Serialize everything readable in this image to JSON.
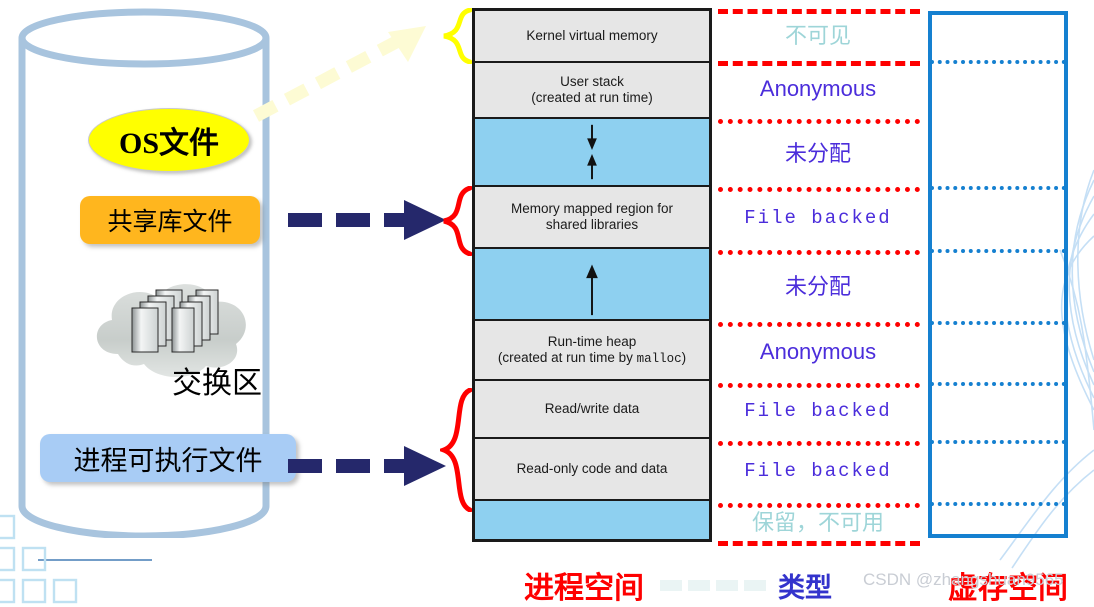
{
  "left_panel": {
    "cylinder_name": "storage-cylinder",
    "os_file": "OS文件",
    "shared_lib_file": "共享库文件",
    "swap_area": "交换区",
    "executable_file": "进程可执行文件"
  },
  "memory_map": {
    "segments": [
      {
        "label": "Kernel virtual memory",
        "sub": "",
        "fill": "gray",
        "arrows": "none"
      },
      {
        "label": "User stack",
        "sub": "(created at run time)",
        "fill": "gray",
        "arrows": "none"
      },
      {
        "label": "",
        "sub": "",
        "fill": "blue",
        "arrows": "both"
      },
      {
        "label": "Memory mapped region for",
        "sub": "shared libraries",
        "fill": "gray",
        "arrows": "none"
      },
      {
        "label": "",
        "sub": "",
        "fill": "blue",
        "arrows": "up"
      },
      {
        "label": "Run-time heap",
        "sub": "(created at run time by malloc)",
        "sub_mono": "malloc",
        "fill": "gray",
        "arrows": "none"
      },
      {
        "label": "Read/write data",
        "sub": "",
        "fill": "gray",
        "arrows": "none"
      },
      {
        "label": "Read-only code and data",
        "sub": "",
        "fill": "gray",
        "arrows": "none"
      },
      {
        "label": "",
        "sub": "",
        "fill": "blue",
        "arrows": "none"
      }
    ]
  },
  "type_column": {
    "rows": [
      {
        "text": "不可见",
        "style": "faint"
      },
      {
        "text": "Anonymous",
        "style": "normal"
      },
      {
        "text": "未分配",
        "style": "normal"
      },
      {
        "text": "File backed",
        "style": "mono"
      },
      {
        "text": "未分配",
        "style": "normal"
      },
      {
        "text": "Anonymous",
        "style": "normal"
      },
      {
        "text": "File backed",
        "style": "mono"
      },
      {
        "text": "File backed",
        "style": "mono"
      },
      {
        "text": "保留，不可用",
        "style": "faint"
      }
    ]
  },
  "legend": {
    "process_space": "进程空间",
    "type": "类型",
    "virtual_space": "虚存空间",
    "watermark": "CSDN @zhangshuan9565"
  },
  "colors": {
    "red_divider": "#fe0000",
    "blue_box": "#1580d0",
    "segment_gray": "#e6e6e6",
    "segment_blue": "#8ed0f0",
    "type_text": "#4b2ddb",
    "faint_text": "#9ed5d8",
    "os_file_fill": "#ffff00",
    "shared_lib_fill": "#ffb61e",
    "exe_fill": "#a8ccf5",
    "arrow_navy": "#25286b",
    "brace_red": "#ff0000",
    "brace_yellow": "#ffff00",
    "cylinder_stroke": "#a8c4de"
  }
}
